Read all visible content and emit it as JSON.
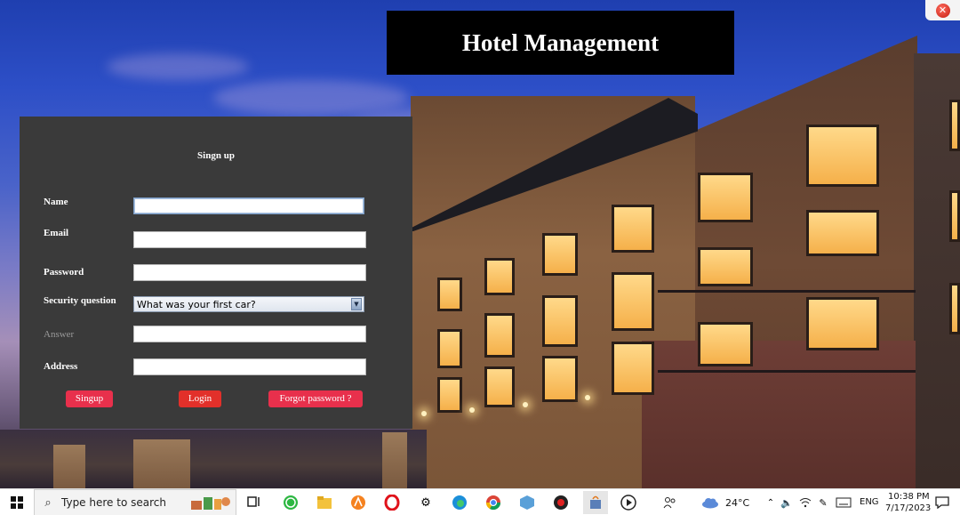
{
  "window": {
    "title": "Hotel Management",
    "close_icon": "close-x-icon"
  },
  "signup": {
    "heading": "Singn up",
    "fields": {
      "name_label": "Name",
      "name_value": "",
      "email_label": "Email",
      "email_value": "",
      "password_label": "Password",
      "password_value": "",
      "security_label": "Security question",
      "security_selected": "What was your first car?",
      "answer_label": "Answer",
      "answer_value": "",
      "address_label": "Address",
      "address_value": ""
    },
    "buttons": {
      "signup": "Singup",
      "login": "Login",
      "forgot": "Forgot password ?"
    }
  },
  "taskbar": {
    "search_placeholder": "Type here to search",
    "weather": "24°C",
    "language": "ENG",
    "time": "10:38 PM",
    "date": "7/17/2023"
  },
  "colors": {
    "panel_bg": "#3a3a3a",
    "button_pink": "#e8304c",
    "button_red": "#e2302a",
    "title_bg": "#000000"
  }
}
